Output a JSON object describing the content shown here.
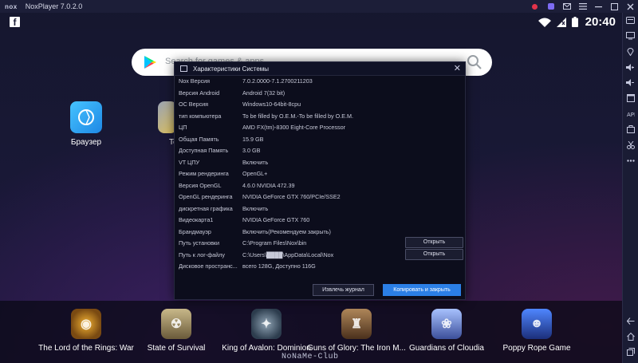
{
  "window": {
    "logo": "nox",
    "title": "NoxPlayer 7.0.2.0"
  },
  "statusbar": {
    "time": "20:40"
  },
  "search": {
    "placeholder": "Search for games & apps"
  },
  "desktop": {
    "browser_label": "Браузер",
    "tools_label": "To"
  },
  "dialog": {
    "title": "Характеристики Системы",
    "rows": [
      {
        "key": "Nox Версия",
        "value": "7.0.2.0000-7.1.2700211203"
      },
      {
        "key": "Версия Android",
        "value": "Android 7(32 bit)"
      },
      {
        "key": "ОС Версия",
        "value": "Windows10-64bit-8cpu"
      },
      {
        "key": "тип компьютера",
        "value": "To be filled by O.E.M.-To be filled by O.E.M."
      },
      {
        "key": "ЦП",
        "value": "AMD FX(tm)-8300 Eight-Core Processor"
      },
      {
        "key": "Общая Память",
        "value": "15.9 GB"
      },
      {
        "key": "Доступная Память",
        "value": "3.0 GB"
      },
      {
        "key": "VT ЦПУ",
        "value": "Включить"
      },
      {
        "key": "Режим рендеринга",
        "value": "OpenGL+"
      },
      {
        "key": "Версия OpenGL",
        "value": "4.6.0 NVIDIA 472.39"
      },
      {
        "key": "OpenGL рендеринга",
        "value": "NVIDIA GeForce GTX 760/PCIe/SSE2"
      },
      {
        "key": "дискретная графика",
        "value": "Включить"
      },
      {
        "key": "Видеокарта1",
        "value": "NVIDIA GeForce GTX 760"
      },
      {
        "key": "Брандмауэр",
        "value": "Включить(Рекомендуем закрыть)"
      },
      {
        "key": "Путь установки",
        "value": "C:\\Program Files\\Nox\\bin"
      },
      {
        "key": "Путь к лог-файлу",
        "value": "C:\\Users\\████\\AppData\\Local\\Nox"
      },
      {
        "key": "Дисковое пространс...",
        "value": "всего  128G, Доступно 116G"
      }
    ],
    "open_label": "Открыть",
    "export_log_label": "Извлечь журнал",
    "copy_close_label": "Копировать и закрыть"
  },
  "dock": {
    "apps": [
      {
        "label": "The Lord of the Rings: War",
        "color": "#7a4a12"
      },
      {
        "label": "State of Survival",
        "color": "#6a5a3a"
      },
      {
        "label": "King of Avalon: Dominion",
        "color": "#2d3d4e"
      },
      {
        "label": "Guns of Glory: The Iron M...",
        "color": "#6b4a2e"
      },
      {
        "label": "Guardians of Cloudia",
        "color": "#3c4f9a"
      },
      {
        "label": "Poppy Rope Game",
        "color": "#2a4fb8"
      }
    ],
    "watermark": "NoNaMe-Club"
  }
}
